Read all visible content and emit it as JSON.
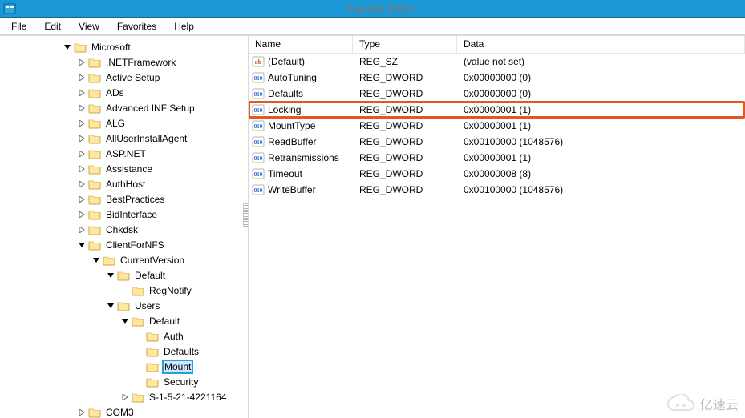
{
  "window": {
    "title": "Registry Editor"
  },
  "menu": {
    "file": "File",
    "edit": "Edit",
    "view": "View",
    "favorites": "Favorites",
    "help": "Help"
  },
  "tree": {
    "root": "Microsoft",
    "items": [
      ".NETFramework",
      "Active Setup",
      "ADs",
      "Advanced INF Setup",
      "ALG",
      "AllUserInstallAgent",
      "ASP.NET",
      "Assistance",
      "AuthHost",
      "BestPractices",
      "BidInterface",
      "Chkdsk"
    ],
    "client_for_nfs": {
      "label": "ClientForNFS",
      "current_version": "CurrentVersion",
      "default1": "Default",
      "regnotify": "RegNotify",
      "users": "Users",
      "default2": "Default",
      "auth": "Auth",
      "defaults": "Defaults",
      "mount": "Mount",
      "security": "Security",
      "sid": "S-1-5-21-4221164"
    },
    "after": "COM3"
  },
  "columns": {
    "name": "Name",
    "type": "Type",
    "data": "Data"
  },
  "values": [
    {
      "name": "(Default)",
      "type": "REG_SZ",
      "data": "(value not set)",
      "kind": "sz",
      "hl": false
    },
    {
      "name": "AutoTuning",
      "type": "REG_DWORD",
      "data": "0x00000000 (0)",
      "kind": "dw",
      "hl": false
    },
    {
      "name": "Defaults",
      "type": "REG_DWORD",
      "data": "0x00000000 (0)",
      "kind": "dw",
      "hl": false
    },
    {
      "name": "Locking",
      "type": "REG_DWORD",
      "data": "0x00000001 (1)",
      "kind": "dw",
      "hl": true
    },
    {
      "name": "MountType",
      "type": "REG_DWORD",
      "data": "0x00000001 (1)",
      "kind": "dw",
      "hl": false
    },
    {
      "name": "ReadBuffer",
      "type": "REG_DWORD",
      "data": "0x00100000 (1048576)",
      "kind": "dw",
      "hl": false
    },
    {
      "name": "Retransmissions",
      "type": "REG_DWORD",
      "data": "0x00000001 (1)",
      "kind": "dw",
      "hl": false
    },
    {
      "name": "Timeout",
      "type": "REG_DWORD",
      "data": "0x00000008 (8)",
      "kind": "dw",
      "hl": false
    },
    {
      "name": "WriteBuffer",
      "type": "REG_DWORD",
      "data": "0x00100000 (1048576)",
      "kind": "dw",
      "hl": false
    }
  ],
  "watermark": "亿速云"
}
